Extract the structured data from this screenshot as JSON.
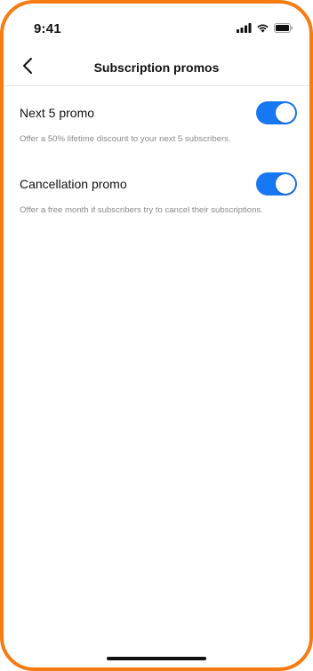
{
  "status_bar": {
    "time": "9:41",
    "icons": [
      "cellular-signal-icon",
      "wifi-icon",
      "battery-icon"
    ]
  },
  "nav": {
    "title": "Subscription promos",
    "back_icon": "chevron-left-icon"
  },
  "settings": [
    {
      "label": "Next 5 promo",
      "description": "Offer a 50% lifetime discount to your next 5 subscribers.",
      "enabled": true
    },
    {
      "label": "Cancellation promo",
      "description": "Offer a free month if subscribers try to cancel their subscriptions.",
      "enabled": true
    }
  ],
  "colors": {
    "frame_border": "#f57c13",
    "toggle_on": "#1877f2",
    "text_primary": "#111111",
    "text_secondary": "#8a8a8a"
  }
}
